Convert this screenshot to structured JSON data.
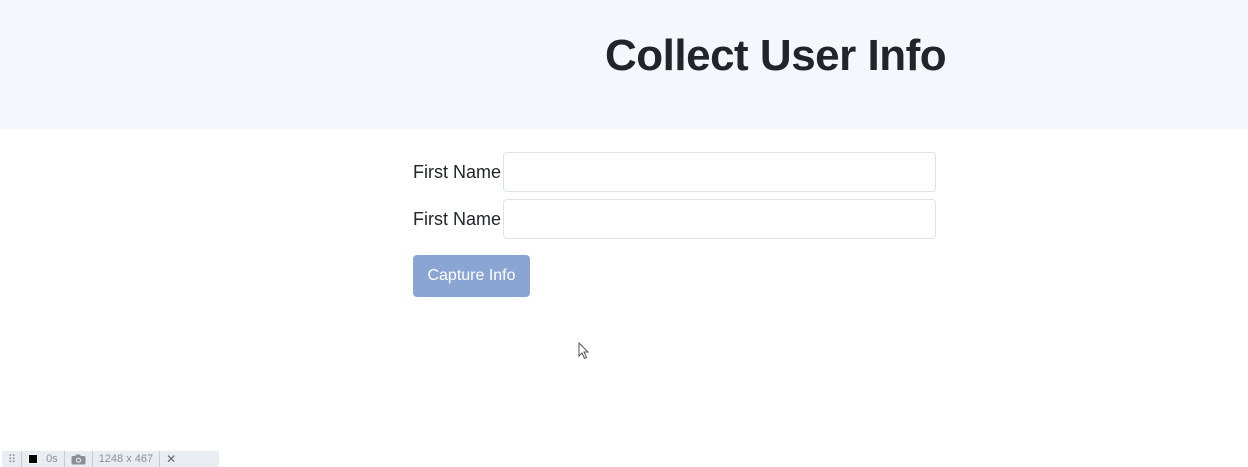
{
  "header": {
    "title": "Collect User Info"
  },
  "form": {
    "fields": [
      {
        "label": "First Name",
        "value": "",
        "placeholder": ""
      },
      {
        "label": "First Name",
        "value": "",
        "placeholder": ""
      }
    ],
    "submit_label": "Capture Info"
  },
  "devtools_bar": {
    "timer": "0s",
    "dimensions": "1248 x 467",
    "icons": [
      "grip-icon",
      "stop-icon",
      "camera-icon",
      "close-icon"
    ],
    "close_label": "✕"
  },
  "colors": {
    "header_bg": "#f4f7fc",
    "button_bg": "#8aa5d4",
    "text": "#212529"
  }
}
